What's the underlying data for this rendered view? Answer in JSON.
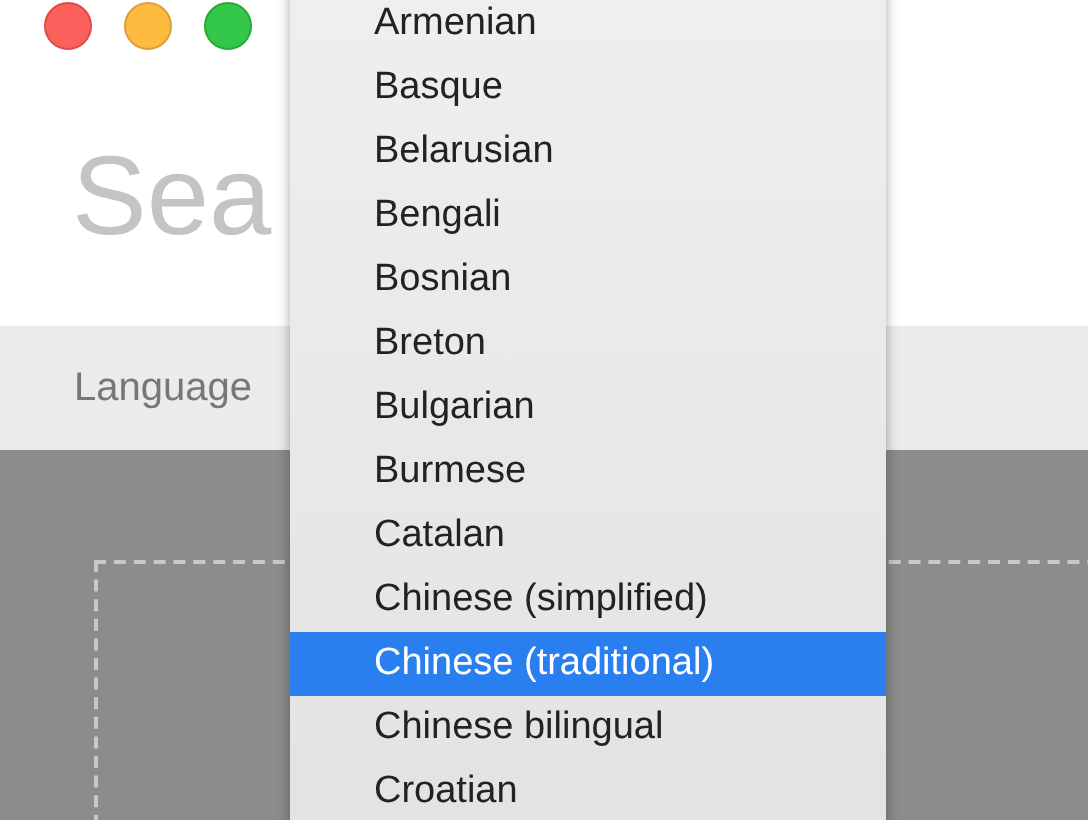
{
  "window": {
    "controls": [
      {
        "kind": "close"
      },
      {
        "kind": "minimize"
      },
      {
        "kind": "zoom"
      }
    ]
  },
  "search": {
    "placeholder": "Sea"
  },
  "toolbar": {
    "label": "Language"
  },
  "menu": {
    "items": [
      {
        "label": "Armenian",
        "selected": false
      },
      {
        "label": "Basque",
        "selected": false
      },
      {
        "label": "Belarusian",
        "selected": false
      },
      {
        "label": "Bengali",
        "selected": false
      },
      {
        "label": "Bosnian",
        "selected": false
      },
      {
        "label": "Breton",
        "selected": false
      },
      {
        "label": "Bulgarian",
        "selected": false
      },
      {
        "label": "Burmese",
        "selected": false
      },
      {
        "label": "Catalan",
        "selected": false
      },
      {
        "label": "Chinese (simplified)",
        "selected": false
      },
      {
        "label": "Chinese (traditional)",
        "selected": true
      },
      {
        "label": "Chinese bilingual",
        "selected": false
      },
      {
        "label": "Croatian",
        "selected": false
      }
    ]
  }
}
